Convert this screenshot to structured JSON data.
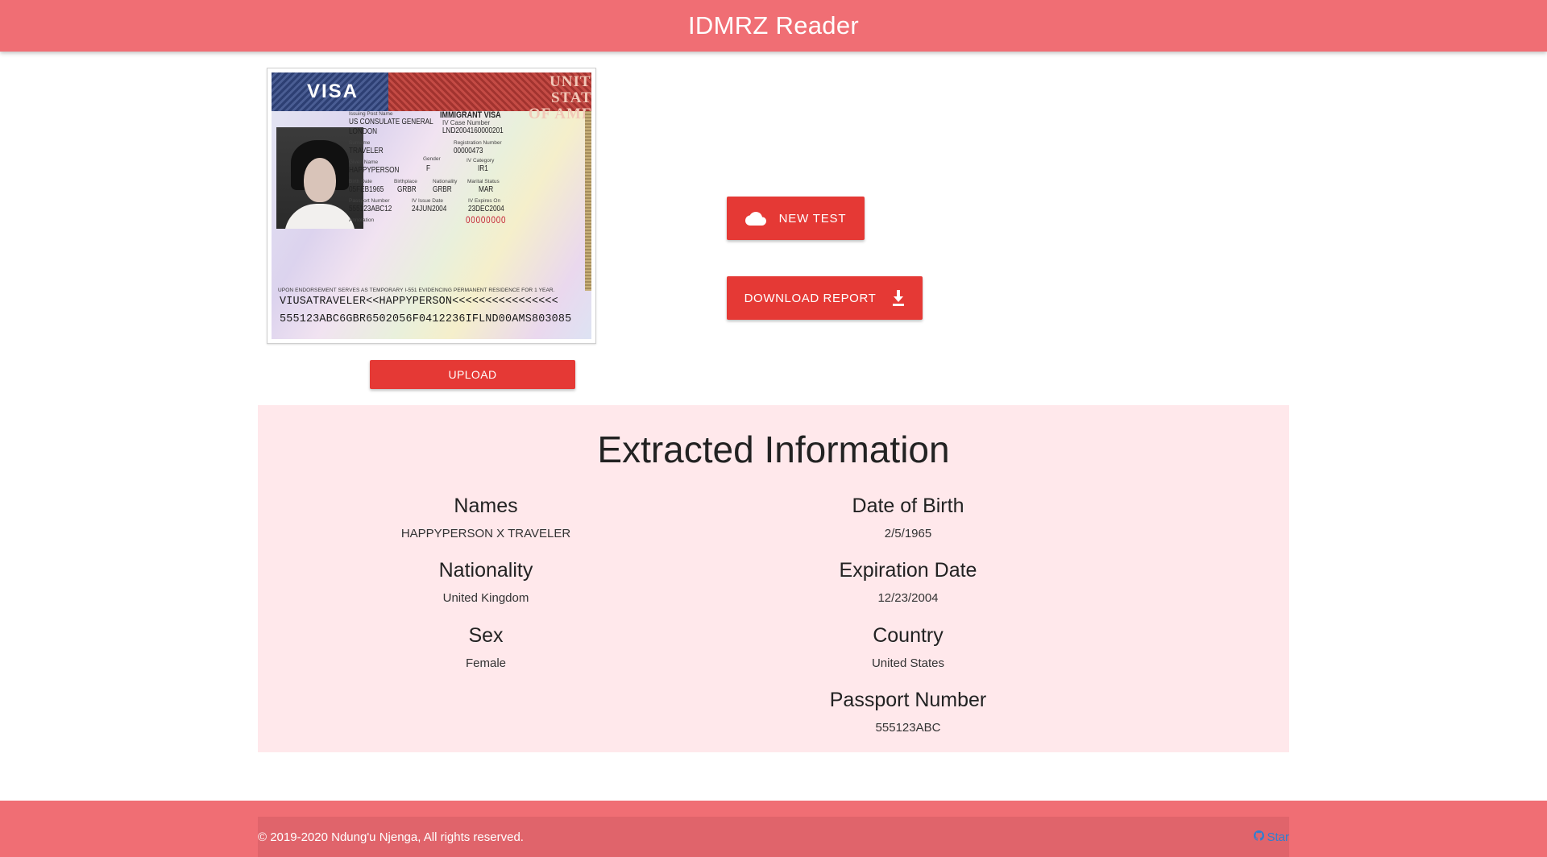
{
  "header": {
    "title": "IDMRZ Reader",
    "bg_color": "#f06e74"
  },
  "visa_image": {
    "title_word": "VISA",
    "country_heading": [
      "UNITED STATES",
      "OF AMERICA"
    ],
    "fields": {
      "issuing_post_label": "Issuing Post Name",
      "issuing_post_value_1": "US CONSULATE GENERAL",
      "issuing_post_value_2": "LONDON",
      "visa_type": "IMMIGRANT VISA",
      "case_number_label": "IV Case Number",
      "case_number_value": "LND2004160000201",
      "surname_label": "Surname",
      "surname_value": "TRAVELER",
      "registration_label": "Registration Number",
      "registration_value": "00000473",
      "given_name_label": "Given Name",
      "given_name_value": "HAPPYPERSON",
      "gender_label": "Gender",
      "gender_value": "F",
      "category_label": "IV Category",
      "category_value": "IR1",
      "birth_date_label": "Birth Date",
      "birth_date_value": "05FEB1965",
      "birthplace_label": "Birthplace",
      "birthplace_value": "GRBR",
      "nationality_label": "Nationality",
      "nationality_value": "GRBR",
      "marital_label": "Marital Status",
      "marital_value": "MAR",
      "passport_label": "Passport Number",
      "passport_value": "555123ABC12",
      "issue_date_label": "IV Issue Date",
      "issue_date_value": "24JUN2004",
      "expires_label": "IV Expires On",
      "expires_value": "23DEC2004",
      "annotation_label": "Annotation",
      "control_number": "00000000"
    },
    "note": "UPON ENDORSEMENT SERVES AS TEMPORARY I-551 EVIDENCING PERMANENT RESIDENCE FOR 1 YEAR.",
    "mrz_line_1": "VIUSATRAVELER<<HAPPYPERSON<<<<<<<<<<<<<<<<",
    "mrz_line_2": "555123ABC6GBR6502056F0412236IFLND00AMS803085"
  },
  "actions": {
    "upload_label": "UPLOAD",
    "new_test_label": "NEW TEST",
    "download_label": "DOWNLOAD REPORT",
    "button_color": "#e53935"
  },
  "extracted": {
    "title": "Extracted Information",
    "fields": [
      {
        "label": "Names",
        "value": "HAPPYPERSON X TRAVELER"
      },
      {
        "label": "Date of Birth",
        "value": "2/5/1965"
      },
      {
        "label": "Nationality",
        "value": "United Kingdom"
      },
      {
        "label": "Expiration Date",
        "value": "12/23/2004"
      },
      {
        "label": "Sex",
        "value": "Female"
      },
      {
        "label": "Country",
        "value": "United States"
      },
      {
        "label": "Passport Number",
        "value": "555123ABC"
      }
    ],
    "bg_color": "#ffe8eb"
  },
  "footer": {
    "copyright": "© 2019-2020 Ndung'u Njenga, All rights reserved.",
    "star_label": "Star"
  }
}
